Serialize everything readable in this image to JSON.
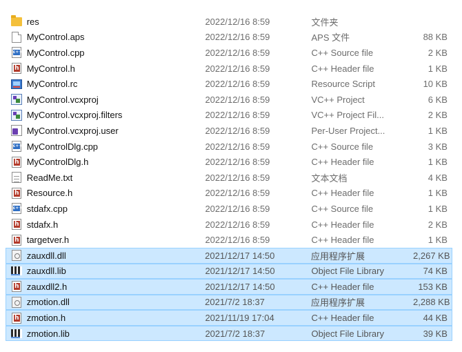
{
  "files": [
    {
      "name": "res",
      "date": "2022/12/16 8:59",
      "type": "文件夹",
      "size": "",
      "icon": "folder-icon",
      "selected": false
    },
    {
      "name": "MyControl.aps",
      "date": "2022/12/16 8:59",
      "type": "APS 文件",
      "size": "88 KB",
      "icon": "blank-file-icon",
      "selected": false
    },
    {
      "name": "MyControl.cpp",
      "date": "2022/12/16 8:59",
      "type": "C++ Source file",
      "size": "2 KB",
      "icon": "cpp-file-icon",
      "selected": false
    },
    {
      "name": "MyControl.h",
      "date": "2022/12/16 8:59",
      "type": "C++ Header file",
      "size": "1 KB",
      "icon": "header-file-icon",
      "selected": false
    },
    {
      "name": "MyControl.rc",
      "date": "2022/12/16 8:59",
      "type": "Resource Script",
      "size": "10 KB",
      "icon": "resource-script-icon",
      "selected": false
    },
    {
      "name": "MyControl.vcxproj",
      "date": "2022/12/16 8:59",
      "type": "VC++ Project",
      "size": "6 KB",
      "icon": "vcxproj-icon",
      "selected": false
    },
    {
      "name": "MyControl.vcxproj.filters",
      "date": "2022/12/16 8:59",
      "type": "VC++ Project Fil...",
      "size": "2 KB",
      "icon": "vcxproj-filters-icon",
      "selected": false
    },
    {
      "name": "MyControl.vcxproj.user",
      "date": "2022/12/16 8:59",
      "type": "Per-User Project...",
      "size": "1 KB",
      "icon": "vcxproj-user-icon",
      "selected": false
    },
    {
      "name": "MyControlDlg.cpp",
      "date": "2022/12/16 8:59",
      "type": "C++ Source file",
      "size": "3 KB",
      "icon": "cpp-file-icon",
      "selected": false
    },
    {
      "name": "MyControlDlg.h",
      "date": "2022/12/16 8:59",
      "type": "C++ Header file",
      "size": "1 KB",
      "icon": "header-file-icon",
      "selected": false
    },
    {
      "name": "ReadMe.txt",
      "date": "2022/12/16 8:59",
      "type": "文本文档",
      "size": "4 KB",
      "icon": "text-file-icon",
      "selected": false
    },
    {
      "name": "Resource.h",
      "date": "2022/12/16 8:59",
      "type": "C++ Header file",
      "size": "1 KB",
      "icon": "header-file-icon",
      "selected": false
    },
    {
      "name": "stdafx.cpp",
      "date": "2022/12/16 8:59",
      "type": "C++ Source file",
      "size": "1 KB",
      "icon": "cpp-file-icon",
      "selected": false
    },
    {
      "name": "stdafx.h",
      "date": "2022/12/16 8:59",
      "type": "C++ Header file",
      "size": "2 KB",
      "icon": "header-file-icon",
      "selected": false
    },
    {
      "name": "targetver.h",
      "date": "2022/12/16 8:59",
      "type": "C++ Header file",
      "size": "1 KB",
      "icon": "header-file-icon",
      "selected": false
    },
    {
      "name": "zauxdll.dll",
      "date": "2021/12/17 14:50",
      "type": "应用程序扩展",
      "size": "2,267 KB",
      "icon": "dll-file-icon",
      "selected": true
    },
    {
      "name": "zauxdll.lib",
      "date": "2021/12/17 14:50",
      "type": "Object File Library",
      "size": "74 KB",
      "icon": "lib-file-icon",
      "selected": true
    },
    {
      "name": "zauxdll2.h",
      "date": "2021/12/17 14:50",
      "type": "C++ Header file",
      "size": "153 KB",
      "icon": "header-file-icon",
      "selected": true
    },
    {
      "name": "zmotion.dll",
      "date": "2021/7/2 18:37",
      "type": "应用程序扩展",
      "size": "2,288 KB",
      "icon": "dll-file-icon",
      "selected": true
    },
    {
      "name": "zmotion.h",
      "date": "2021/11/19 17:04",
      "type": "C++ Header file",
      "size": "44 KB",
      "icon": "header-file-icon",
      "selected": true
    },
    {
      "name": "zmotion.lib",
      "date": "2021/7/2 18:37",
      "type": "Object File Library",
      "size": "39 KB",
      "icon": "lib-file-icon",
      "selected": true
    }
  ],
  "colors": {
    "selection_background": "#cce8ff",
    "selection_border": "#99d1ff",
    "secondary_text": "#6d6d6d",
    "folder": "#f4c03b",
    "header_badge": "#b23a2a",
    "cpp_badge": "#2f6fc4"
  }
}
